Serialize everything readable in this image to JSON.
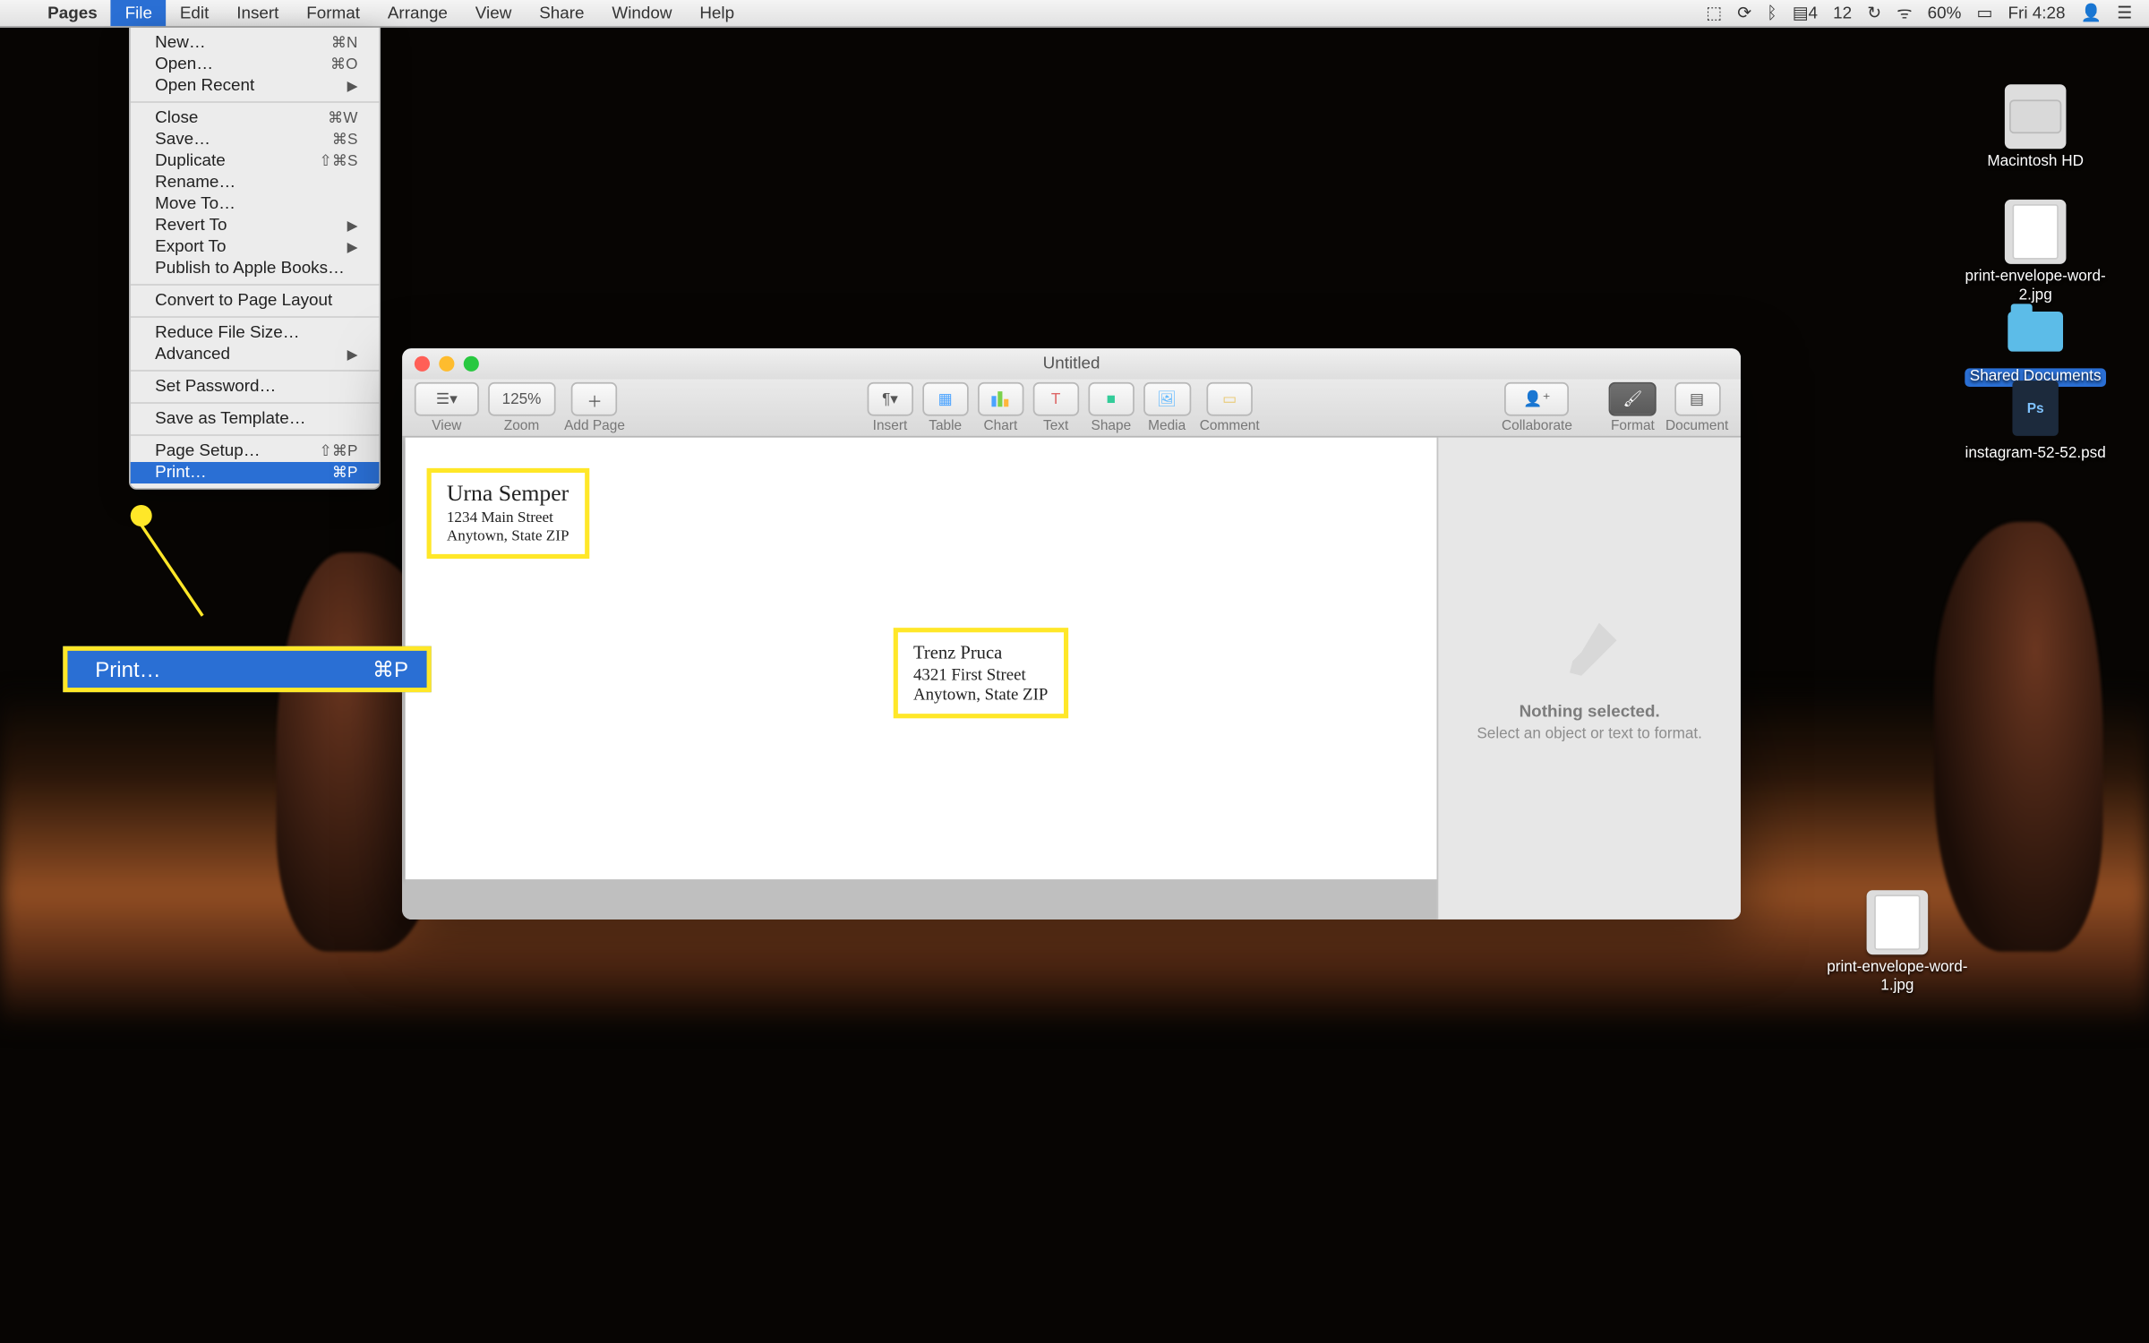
{
  "menubar": {
    "app": "Pages",
    "items": [
      "File",
      "Edit",
      "Insert",
      "Format",
      "Arrange",
      "View",
      "Share",
      "Window",
      "Help"
    ],
    "open_index": 0,
    "right": {
      "date_icon": "12",
      "wifi_pct": "60%",
      "clock": "Fri 4:28"
    }
  },
  "file_menu": [
    {
      "label": "New…",
      "shortcut": "⌘N"
    },
    {
      "label": "Open…",
      "shortcut": "⌘O"
    },
    {
      "label": "Open Recent",
      "sub": true
    },
    {
      "label": "Close",
      "shortcut": "⌘W",
      "sep": true
    },
    {
      "label": "Save…",
      "shortcut": "⌘S"
    },
    {
      "label": "Duplicate",
      "shortcut": "⇧⌘S"
    },
    {
      "label": "Rename…"
    },
    {
      "label": "Move To…"
    },
    {
      "label": "Revert To",
      "sub": true
    },
    {
      "label": "Export To",
      "sub": true
    },
    {
      "label": "Publish to Apple Books…"
    },
    {
      "label": "Convert to Page Layout",
      "sep": true
    },
    {
      "label": "Reduce File Size…",
      "sep": true
    },
    {
      "label": "Advanced",
      "sub": true
    },
    {
      "label": "Set Password…",
      "sep": true
    },
    {
      "label": "Save as Template…",
      "sep": true
    },
    {
      "label": "Page Setup…",
      "shortcut": "⇧⌘P",
      "sep": true
    },
    {
      "label": "Print…",
      "shortcut": "⌘P",
      "selected": true
    }
  ],
  "callout": {
    "label": "Print…",
    "shortcut": "⌘P"
  },
  "window": {
    "title": "Untitled",
    "toolbar": {
      "view": "View",
      "zoom": "Zoom",
      "zoom_value": "125%",
      "add_page": "Add Page",
      "insert": "Insert",
      "table": "Table",
      "chart": "Chart",
      "text": "Text",
      "shape": "Shape",
      "media": "Media",
      "comment": "Comment",
      "collaborate": "Collaborate",
      "format": "Format",
      "document": "Document"
    },
    "envelope": {
      "return": {
        "name": "Urna Semper",
        "line1": "1234 Main Street",
        "line2": "Anytown, State ZIP"
      },
      "to": {
        "name": "Trenz Pruca",
        "line1": "4321 First Street",
        "line2": "Anytown, State ZIP"
      }
    },
    "inspector": {
      "msg1": "Nothing selected.",
      "msg2": "Select an object or text to format."
    }
  },
  "desktop_icons": {
    "hd": "Macintosh HD",
    "img1": "print-envelope-word-2.jpg",
    "shared": "Shared Documents",
    "psd": "instagram-52-52.psd",
    "img2": "print-envelope-word-1.jpg"
  }
}
